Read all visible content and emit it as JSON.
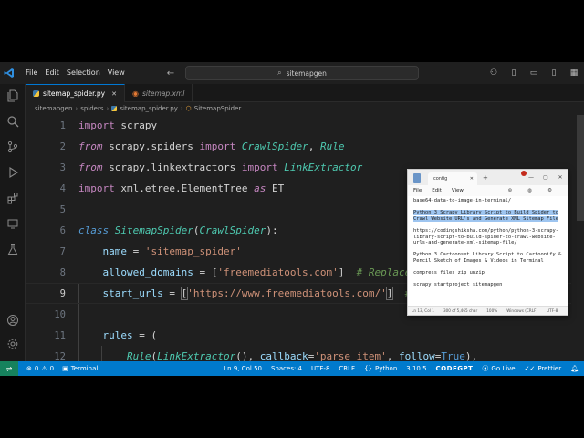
{
  "window": {
    "menu": [
      "File",
      "Edit",
      "Selection",
      "View"
    ],
    "command_center": "sitemapgen"
  },
  "tabs": [
    {
      "label": "sitemap_spider.py",
      "active": true
    },
    {
      "label": "sitemap.xml",
      "active": false
    }
  ],
  "breadcrumb": [
    "sitemapgen",
    "spiders",
    "sitemap_spider.py",
    "SitemapSpider"
  ],
  "editor": {
    "line_numbers": [
      "1",
      "2",
      "3",
      "4",
      "5",
      "6",
      "7",
      "8",
      "9",
      "10",
      "11",
      "12"
    ],
    "current_line": "9"
  },
  "notepad": {
    "tab_label": "config",
    "menu": [
      "File",
      "Edit",
      "View"
    ],
    "paragraphs": [
      "base64-data-to-image-in-terminal/",
      "Python 3 Scrapy Library Script to Build Spider to Crawl Website URL's and Generate XML Sitemap File",
      "https://codingshiksha.com/python/python-3-scrapy-library-script-to-build-spider-to-crawl-website-urls-and-generate-xml-sitemap-file/",
      "Python 3 Cartoonset Library Script to Cartoonify & Pencil Sketch of Images & Videos in Terminal",
      "compress files zip unzip",
      "scrapy startproject sitemapgen"
    ],
    "status": [
      "Ln 13, Col 1",
      "300 of 5,465 char",
      "100%",
      "Windows (CRLF)",
      "UTF-8"
    ]
  },
  "statusbar": {
    "errors": "0",
    "warnings": "0",
    "terminal": "Terminal",
    "position": "Ln 9, Col 50",
    "spaces": "Spaces: 4",
    "encoding": "UTF-8",
    "eol": "CRLF",
    "language": "Python",
    "python_version": "3.10.5",
    "codegpt": "CODEGPT",
    "golive": "Go Live",
    "prettier": "Prettier"
  },
  "colors": {
    "statusbar_bg": "#007acc",
    "editor_bg": "#1f1f1f",
    "keyword": "#c586c0",
    "class": "#4ec9b0",
    "string": "#ce9178",
    "comment": "#6a9955"
  }
}
